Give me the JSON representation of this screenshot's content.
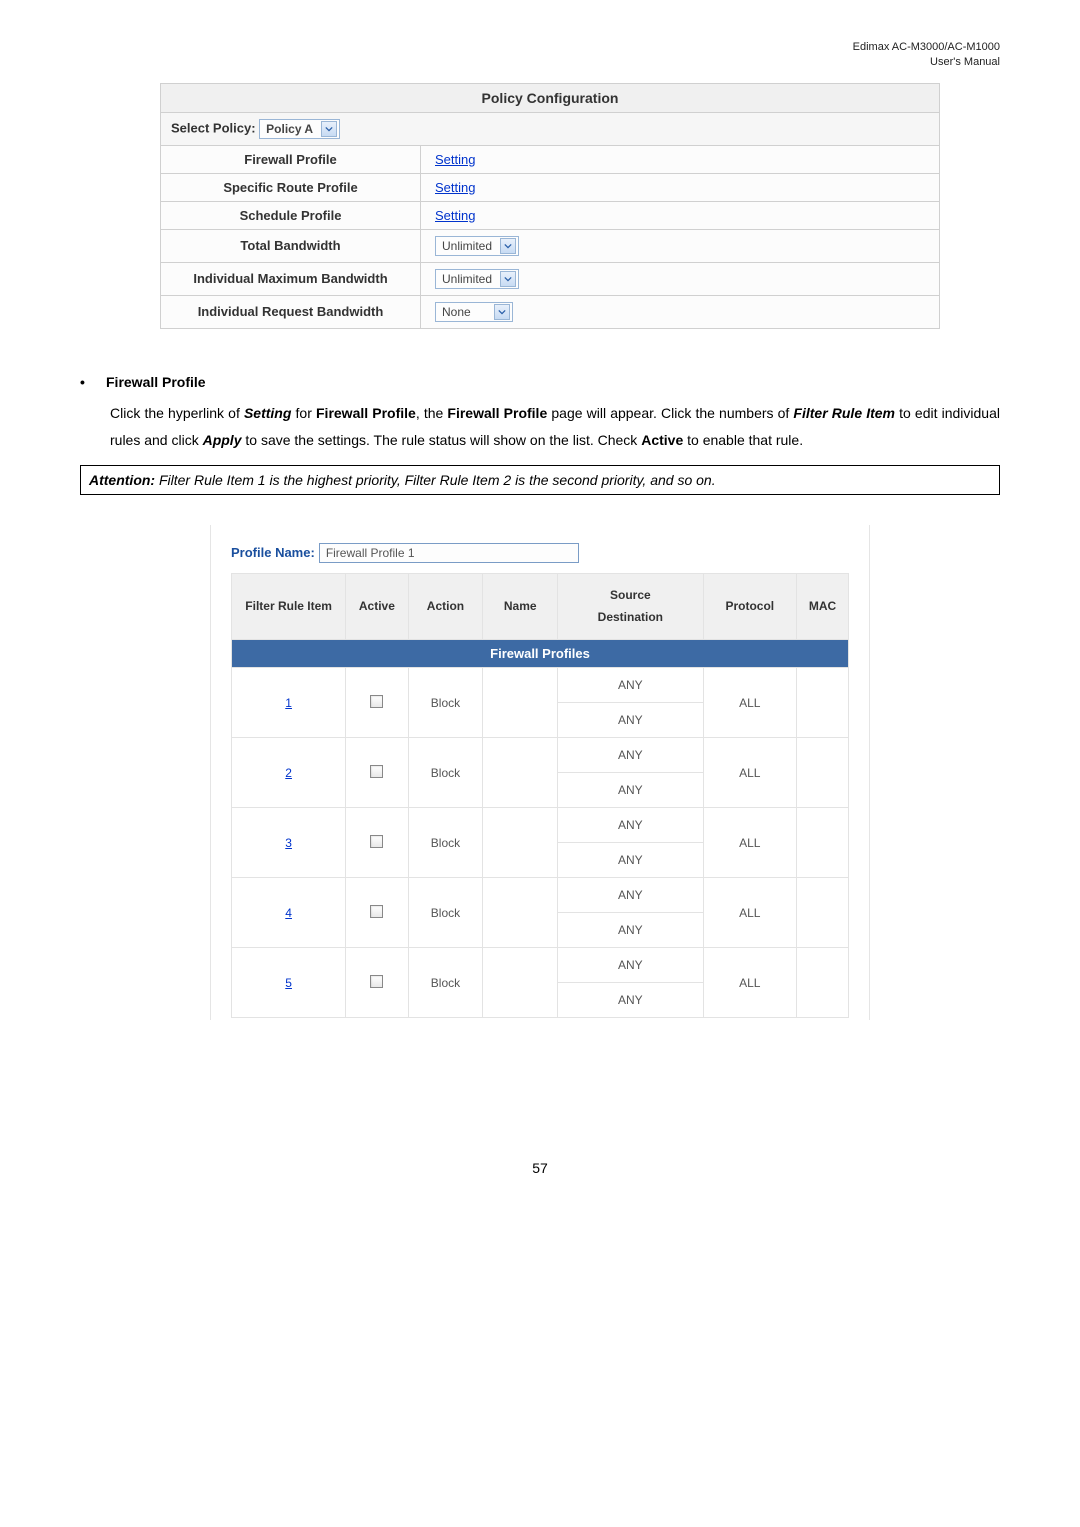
{
  "header": {
    "line1": "Edimax AC-M3000/AC-M1000",
    "line2": "User's Manual"
  },
  "policy": {
    "title": "Policy Configuration",
    "select_label": "Select Policy:",
    "select_value": "Policy A",
    "rows": {
      "firewall_label": "Firewall Profile",
      "firewall_value": "Setting",
      "route_label": "Specific Route Profile",
      "route_value": "Setting",
      "schedule_label": "Schedule Profile",
      "schedule_value": "Setting",
      "total_bw_label": "Total Bandwidth",
      "total_bw_value": "Unlimited",
      "ind_max_bw_label": "Individual Maximum Bandwidth",
      "ind_max_bw_value": "Unlimited",
      "ind_req_bw_label": "Individual Request Bandwidth",
      "ind_req_bw_value": "None"
    }
  },
  "content": {
    "bullet_title": "Firewall Profile",
    "p_part1": "Click the hyperlink of ",
    "p_setting": "Setting",
    "p_part2": " for ",
    "p_fw_profile_b": "Firewall Profile",
    "p_part3": ", the ",
    "p_fw_profile_b2": "Firewall Profile",
    "p_part4": " page will appear. Click the numbers of ",
    "p_filter_rule": "Filter Rule Item",
    "p_part5": " to edit individual rules and click ",
    "p_apply": "Apply",
    "p_part6": " to save the settings. The rule status will show on the list. Check ",
    "p_active": "Active",
    "p_part7": " to enable that rule."
  },
  "attention": {
    "label": "Attention:",
    "text": " Filter Rule Item 1 is the highest priority, Filter Rule Item 2 is the second priority, and so on."
  },
  "firewall": {
    "profile_name_label": "Profile Name:",
    "profile_name_value": "Firewall Profile 1",
    "title": "Firewall Profiles",
    "headers": {
      "rule": "Filter Rule Item",
      "active": "Active",
      "action": "Action",
      "name": "Name",
      "source": "Source",
      "destination": "Destination",
      "protocol": "Protocol",
      "mac": "MAC"
    },
    "rows": [
      {
        "num": "1",
        "action": "Block",
        "src": "ANY",
        "dst": "ANY",
        "proto": "ALL"
      },
      {
        "num": "2",
        "action": "Block",
        "src": "ANY",
        "dst": "ANY",
        "proto": "ALL"
      },
      {
        "num": "3",
        "action": "Block",
        "src": "ANY",
        "dst": "ANY",
        "proto": "ALL"
      },
      {
        "num": "4",
        "action": "Block",
        "src": "ANY",
        "dst": "ANY",
        "proto": "ALL"
      },
      {
        "num": "5",
        "action": "Block",
        "src": "ANY",
        "dst": "ANY",
        "proto": "ALL"
      }
    ]
  },
  "page_number": "57"
}
